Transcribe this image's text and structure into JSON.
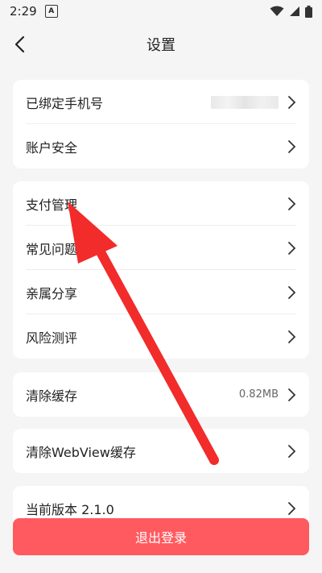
{
  "status_bar": {
    "time": "2:29",
    "notif_letter": "A"
  },
  "nav": {
    "title": "设置"
  },
  "cards": [
    {
      "items": [
        {
          "label": "已绑定手机号"
        },
        {
          "label": "账户安全"
        }
      ]
    },
    {
      "items": [
        {
          "label": "支付管理"
        },
        {
          "label": "常见问题"
        },
        {
          "label": "亲属分享"
        },
        {
          "label": "风险测评"
        }
      ]
    },
    {
      "items": [
        {
          "label": "清除缓存",
          "value": "0.82MB"
        }
      ]
    },
    {
      "items": [
        {
          "label": "清除WebView缓存"
        }
      ]
    },
    {
      "items": [
        {
          "label": "当前版本 2.1.0"
        }
      ]
    }
  ],
  "logout": {
    "label": "退出登录"
  },
  "colors": {
    "accent": "#ff5a5f",
    "arrow": "#f22b2b",
    "bg": "#f5f5f5"
  }
}
